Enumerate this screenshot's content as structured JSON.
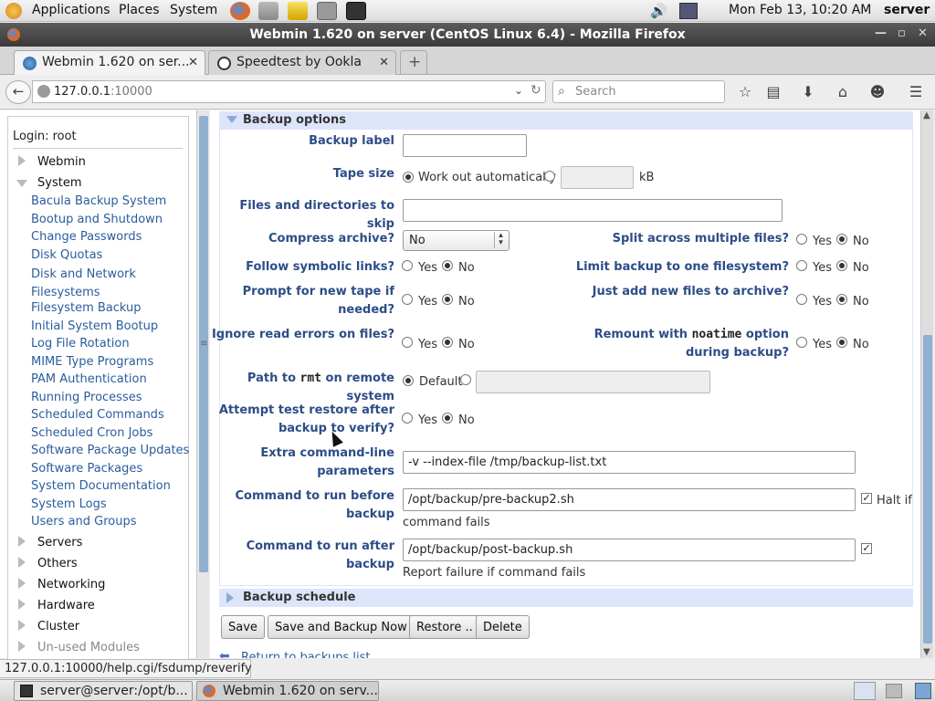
{
  "panel": {
    "menus": [
      "Applications",
      "Places",
      "System"
    ],
    "clock": "Mon Feb 13, 10:20 AM",
    "user": "server"
  },
  "window": {
    "title": "Webmin 1.620 on server (CentOS Linux 6.4) - Mozilla Firefox"
  },
  "tabs": [
    {
      "label": "Webmin 1.620 on ser..."
    },
    {
      "label": "Speedtest by Ookla"
    }
  ],
  "nav": {
    "url_host": "127.0.0.1",
    "url_port": ":10000",
    "search_placeholder": "Search"
  },
  "sidebar": {
    "login": "Login: root",
    "categories": [
      "Webmin",
      "System",
      "Servers",
      "Others",
      "Networking",
      "Hardware",
      "Cluster",
      "Un-used Modules"
    ],
    "system_modules": [
      "Bacula Backup System",
      "Bootup and Shutdown",
      "Change Passwords",
      "Disk Quotas",
      "Disk and Network Filesystems",
      "Filesystem Backup",
      "Initial System Bootup",
      "Log File Rotation",
      "MIME Type Programs",
      "PAM Authentication",
      "Running Processes",
      "Scheduled Commands",
      "Scheduled Cron Jobs",
      "Software Package Updates",
      "Software Packages",
      "System Documentation",
      "System Logs",
      "Users and Groups"
    ],
    "disk_net_line1": "Disk and Network",
    "disk_net_line2": "Filesystems"
  },
  "form": {
    "section_backup_options": "Backup options",
    "section_backup_schedule": "Backup schedule",
    "backup_label": {
      "label": "Backup label",
      "value": ""
    },
    "tape_size": {
      "label": "Tape size",
      "auto": "Work out automatically",
      "unit": "kB",
      "value": ""
    },
    "skip": {
      "label": "Files and directories to skip",
      "value": ""
    },
    "compress": {
      "label": "Compress archive?",
      "value": "No"
    },
    "split": {
      "label": "Split across multiple files?"
    },
    "follow": {
      "label": "Follow symbolic links?"
    },
    "limit": {
      "label": "Limit backup to one filesystem?"
    },
    "prompt": {
      "label1": "Prompt for new tape if",
      "label2": "needed?"
    },
    "justadd": {
      "label": "Just add new files to archive?"
    },
    "ignore": {
      "label": "Ignore read errors on files?"
    },
    "remount": {
      "label1a": "Remount with ",
      "label1code": "noatime",
      "label1b": " option",
      "label2": "during backup?"
    },
    "rmt": {
      "label_a": "Path to ",
      "label_code": "rmt",
      "label_b": " on remote system",
      "default": "Default",
      "value": ""
    },
    "attempt": {
      "label1": "Attempt test restore after",
      "label2": "backup to verify?"
    },
    "extra": {
      "label1": "Extra command-line",
      "label2": "parameters",
      "value": "-v --index-file /tmp/backup-list.txt"
    },
    "before": {
      "label1": "Command to run before",
      "label2": "backup",
      "value": "/opt/backup/pre-backup2.sh",
      "halt": "Halt if",
      "halt2": "command fails"
    },
    "after": {
      "label": "Command to run after backup",
      "value": "/opt/backup/post-backup.sh",
      "report": "Report failure if command fails"
    },
    "yes": "Yes",
    "no": "No"
  },
  "buttons": {
    "save": "Save",
    "save_now": "Save and Backup Now",
    "restore": "Restore ..",
    "delete": "Delete"
  },
  "return_link": "Return to backups list",
  "status_url": "127.0.0.1:10000/help.cgi/fsdump/reverify",
  "taskbar": [
    {
      "label": "server@server:/opt/b..."
    },
    {
      "label": "Webmin 1.620 on serv..."
    }
  ]
}
